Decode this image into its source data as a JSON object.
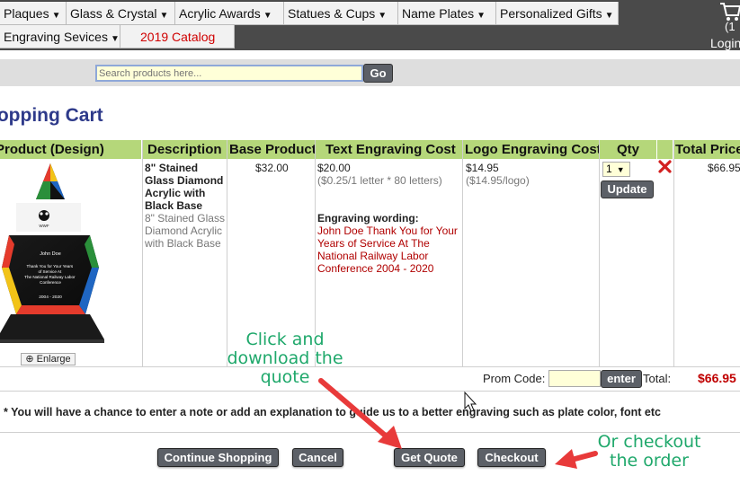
{
  "nav": {
    "row1": [
      {
        "label": "Plaques"
      },
      {
        "label": "Glass & Crystal"
      },
      {
        "label": "Acrylic Awards"
      },
      {
        "label": "Statues & Cups"
      },
      {
        "label": "Name Plates"
      },
      {
        "label": "Personalized Gifts"
      }
    ],
    "row2": [
      {
        "label": "Engraving Sevices"
      },
      {
        "label": "2019 Catalog"
      }
    ],
    "cart_count": "(1",
    "login": "Login"
  },
  "search": {
    "placeholder": "Search products here...",
    "go_label": "Go"
  },
  "page_title": "Shopping Cart",
  "table": {
    "headers": [
      "Product (Design)",
      "Description",
      "Base Product",
      "Text Engraving Cost",
      "Logo Engraving Cost",
      "Qty",
      "Total Price"
    ],
    "row": {
      "description_title": "8\" Stained Glass Diamond Acrylic with Black Base",
      "description_sub": "8\" Stained Glass Diamond Acrylic with Black Base",
      "base_price": "$32.00",
      "text_cost": "$20.00",
      "text_cost_detail": "($0.25/1 letter * 80 letters)",
      "wording_label": "Engraving wording:",
      "wording": "John Doe Thank You for Your Years of Service At The National Railway Labor Conference 2004 - 2020",
      "logo_cost": "$14.95",
      "logo_cost_detail": "($14.95/logo)",
      "qty": "1",
      "update_label": "Update",
      "total": "$66.95",
      "enlarge_label": "Enlarge",
      "award_name": "John Doe",
      "award_text": "Thank You for Your Years of Service At The National Railway Labor Conference",
      "award_years": "2004 - 2020",
      "award_logo": "WWF"
    }
  },
  "promo": {
    "label": "Prom Code:",
    "enter_label": "enter",
    "total_label": "Total:",
    "total_value": "$66.95"
  },
  "note": "* You will have a chance to enter a note or add an explanation to guide us to a better engraving such as plate color, font etc",
  "buttons": {
    "continue": "Continue Shopping",
    "cancel": "Cancel",
    "quote": "Get Quote",
    "checkout": "Checkout"
  },
  "callouts": {
    "quote": [
      "Click and",
      "download the",
      "quote"
    ],
    "checkout": [
      "Or checkout",
      "the order"
    ]
  },
  "colors": {
    "header_green": "#b5d77a",
    "title_blue": "#2e3a8a",
    "price_red": "#c00000",
    "callout_green": "#1fa86b",
    "arrow_red": "#e83a3a"
  }
}
